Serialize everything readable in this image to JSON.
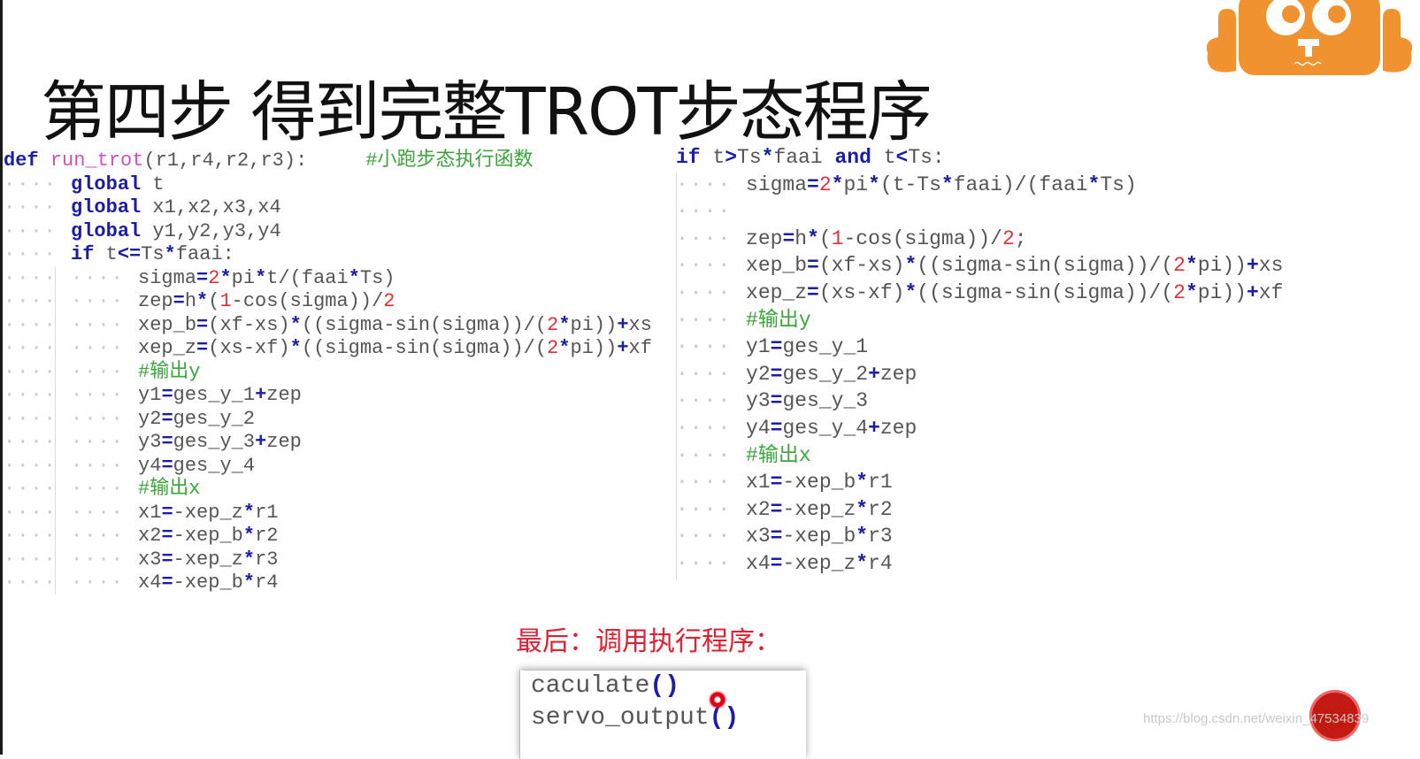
{
  "slide": {
    "title": "第四步 得到完整TROT步态程序",
    "watermark": "https://blog.csdn.net/weixin_47534839",
    "colors": {
      "keyword": "#1c1ca6",
      "function_name": "#d64fb8",
      "number": "#e0303a",
      "comment": "#3aa63a",
      "text": "#555555",
      "logo": "#f0922f",
      "final_label": "#e02030"
    }
  },
  "code_left": {
    "lines": [
      {
        "indent": 0,
        "tokens": [
          [
            "kw",
            "def"
          ],
          [
            "tx",
            " "
          ],
          [
            "fn",
            "run_trot"
          ],
          [
            "tx",
            "(r1,r4,r2,r3):"
          ],
          [
            "tx",
            "     "
          ],
          [
            "cm",
            "#小跑步态执行函数"
          ]
        ]
      },
      {
        "indent": 1,
        "tokens": [
          [
            "kw",
            "global"
          ],
          [
            "tx",
            " t"
          ]
        ]
      },
      {
        "indent": 1,
        "tokens": [
          [
            "kw",
            "global"
          ],
          [
            "tx",
            " x1,x2,x3,x4"
          ]
        ]
      },
      {
        "indent": 1,
        "tokens": [
          [
            "kw",
            "global"
          ],
          [
            "tx",
            " y1,y2,y3,y4"
          ]
        ]
      },
      {
        "indent": 1,
        "tokens": [
          [
            "kw",
            "if"
          ],
          [
            "tx",
            " t"
          ],
          [
            "op",
            "<="
          ],
          [
            "tx",
            "Ts"
          ],
          [
            "op",
            "*"
          ],
          [
            "tx",
            "faai:"
          ]
        ]
      },
      {
        "indent": 2,
        "tokens": [
          [
            "tx",
            "sigma"
          ],
          [
            "op",
            "="
          ],
          [
            "num",
            "2"
          ],
          [
            "op",
            "*"
          ],
          [
            "tx",
            "pi"
          ],
          [
            "op",
            "*"
          ],
          [
            "tx",
            "t/(faai"
          ],
          [
            "op",
            "*"
          ],
          [
            "tx",
            "Ts)"
          ]
        ]
      },
      {
        "indent": 2,
        "tokens": [
          [
            "tx",
            "zep"
          ],
          [
            "op",
            "="
          ],
          [
            "tx",
            "h"
          ],
          [
            "op",
            "*"
          ],
          [
            "tx",
            "("
          ],
          [
            "num",
            "1"
          ],
          [
            "tx",
            "-cos(sigma))/"
          ],
          [
            "num",
            "2"
          ]
        ]
      },
      {
        "indent": 2,
        "tokens": [
          [
            "tx",
            "xep_b"
          ],
          [
            "op",
            "="
          ],
          [
            "tx",
            "(xf-xs)"
          ],
          [
            "op",
            "*"
          ],
          [
            "tx",
            "((sigma-sin(sigma))/("
          ],
          [
            "num",
            "2"
          ],
          [
            "op",
            "*"
          ],
          [
            "tx",
            "pi))"
          ],
          [
            "op",
            "+"
          ],
          [
            "tx",
            "xs"
          ]
        ]
      },
      {
        "indent": 2,
        "tokens": [
          [
            "tx",
            "xep_z"
          ],
          [
            "op",
            "="
          ],
          [
            "tx",
            "(xs-xf)"
          ],
          [
            "op",
            "*"
          ],
          [
            "tx",
            "((sigma-sin(sigma))/("
          ],
          [
            "num",
            "2"
          ],
          [
            "op",
            "*"
          ],
          [
            "tx",
            "pi))"
          ],
          [
            "op",
            "+"
          ],
          [
            "tx",
            "xf"
          ]
        ]
      },
      {
        "indent": 2,
        "tokens": [
          [
            "cm",
            "#输出y"
          ]
        ]
      },
      {
        "indent": 2,
        "tokens": [
          [
            "tx",
            "y1"
          ],
          [
            "op",
            "="
          ],
          [
            "tx",
            "ges_y_1"
          ],
          [
            "op",
            "+"
          ],
          [
            "tx",
            "zep"
          ]
        ]
      },
      {
        "indent": 2,
        "tokens": [
          [
            "tx",
            "y2"
          ],
          [
            "op",
            "="
          ],
          [
            "tx",
            "ges_y_2"
          ]
        ]
      },
      {
        "indent": 2,
        "tokens": [
          [
            "tx",
            "y3"
          ],
          [
            "op",
            "="
          ],
          [
            "tx",
            "ges_y_3"
          ],
          [
            "op",
            "+"
          ],
          [
            "tx",
            "zep"
          ]
        ]
      },
      {
        "indent": 2,
        "tokens": [
          [
            "tx",
            "y4"
          ],
          [
            "op",
            "="
          ],
          [
            "tx",
            "ges_y_4"
          ]
        ]
      },
      {
        "indent": 2,
        "tokens": [
          [
            "cm",
            "#输出x"
          ]
        ]
      },
      {
        "indent": 2,
        "tokens": [
          [
            "tx",
            "x1"
          ],
          [
            "op",
            "="
          ],
          [
            "tx",
            "-xep_z"
          ],
          [
            "op",
            "*"
          ],
          [
            "tx",
            "r1"
          ]
        ]
      },
      {
        "indent": 2,
        "tokens": [
          [
            "tx",
            "x2"
          ],
          [
            "op",
            "="
          ],
          [
            "tx",
            "-xep_b"
          ],
          [
            "op",
            "*"
          ],
          [
            "tx",
            "r2"
          ]
        ]
      },
      {
        "indent": 2,
        "tokens": [
          [
            "tx",
            "x3"
          ],
          [
            "op",
            "="
          ],
          [
            "tx",
            "-xep_z"
          ],
          [
            "op",
            "*"
          ],
          [
            "tx",
            "r3"
          ]
        ]
      },
      {
        "indent": 2,
        "tokens": [
          [
            "tx",
            "x4"
          ],
          [
            "op",
            "="
          ],
          [
            "tx",
            "-xep_b"
          ],
          [
            "op",
            "*"
          ],
          [
            "tx",
            "r4"
          ]
        ]
      }
    ]
  },
  "code_right": {
    "lines": [
      {
        "indent": 0,
        "tokens": [
          [
            "kw",
            "if"
          ],
          [
            "tx",
            " t"
          ],
          [
            "op",
            ">"
          ],
          [
            "tx",
            "Ts"
          ],
          [
            "op",
            "*"
          ],
          [
            "tx",
            "faai "
          ],
          [
            "kw",
            "and"
          ],
          [
            "tx",
            " t"
          ],
          [
            "op",
            "<"
          ],
          [
            "tx",
            "Ts:"
          ]
        ]
      },
      {
        "indent": 1,
        "tokens": [
          [
            "tx",
            "sigma"
          ],
          [
            "op",
            "="
          ],
          [
            "num",
            "2"
          ],
          [
            "op",
            "*"
          ],
          [
            "tx",
            "pi"
          ],
          [
            "op",
            "*"
          ],
          [
            "tx",
            "(t-Ts"
          ],
          [
            "op",
            "*"
          ],
          [
            "tx",
            "faai)/(faai"
          ],
          [
            "op",
            "*"
          ],
          [
            "tx",
            "Ts)"
          ]
        ]
      },
      {
        "indent": 1,
        "tokens": []
      },
      {
        "indent": 1,
        "tokens": [
          [
            "tx",
            "zep"
          ],
          [
            "op",
            "="
          ],
          [
            "tx",
            "h"
          ],
          [
            "op",
            "*"
          ],
          [
            "tx",
            "("
          ],
          [
            "num",
            "1"
          ],
          [
            "tx",
            "-cos(sigma))/"
          ],
          [
            "num",
            "2"
          ],
          [
            "tx",
            ";"
          ]
        ]
      },
      {
        "indent": 1,
        "tokens": [
          [
            "tx",
            "xep_b"
          ],
          [
            "op",
            "="
          ],
          [
            "tx",
            "(xf-xs)"
          ],
          [
            "op",
            "*"
          ],
          [
            "tx",
            "((sigma-sin(sigma))/("
          ],
          [
            "num",
            "2"
          ],
          [
            "op",
            "*"
          ],
          [
            "tx",
            "pi))"
          ],
          [
            "op",
            "+"
          ],
          [
            "tx",
            "xs"
          ]
        ]
      },
      {
        "indent": 1,
        "tokens": [
          [
            "tx",
            "xep_z"
          ],
          [
            "op",
            "="
          ],
          [
            "tx",
            "(xs-xf)"
          ],
          [
            "op",
            "*"
          ],
          [
            "tx",
            "((sigma-sin(sigma))/("
          ],
          [
            "num",
            "2"
          ],
          [
            "op",
            "*"
          ],
          [
            "tx",
            "pi))"
          ],
          [
            "op",
            "+"
          ],
          [
            "tx",
            "xf"
          ]
        ]
      },
      {
        "indent": 1,
        "tokens": [
          [
            "cm",
            "#输出y"
          ]
        ]
      },
      {
        "indent": 1,
        "tokens": [
          [
            "tx",
            "y1"
          ],
          [
            "op",
            "="
          ],
          [
            "tx",
            "ges_y_1"
          ]
        ]
      },
      {
        "indent": 1,
        "tokens": [
          [
            "tx",
            "y2"
          ],
          [
            "op",
            "="
          ],
          [
            "tx",
            "ges_y_2"
          ],
          [
            "op",
            "+"
          ],
          [
            "tx",
            "zep"
          ]
        ]
      },
      {
        "indent": 1,
        "tokens": [
          [
            "tx",
            "y3"
          ],
          [
            "op",
            "="
          ],
          [
            "tx",
            "ges_y_3"
          ]
        ]
      },
      {
        "indent": 1,
        "tokens": [
          [
            "tx",
            "y4"
          ],
          [
            "op",
            "="
          ],
          [
            "tx",
            "ges_y_4"
          ],
          [
            "op",
            "+"
          ],
          [
            "tx",
            "zep"
          ]
        ]
      },
      {
        "indent": 1,
        "tokens": [
          [
            "cm",
            "#输出x"
          ]
        ]
      },
      {
        "indent": 1,
        "tokens": [
          [
            "tx",
            "x1"
          ],
          [
            "op",
            "="
          ],
          [
            "tx",
            "-xep_b"
          ],
          [
            "op",
            "*"
          ],
          [
            "tx",
            "r1"
          ]
        ]
      },
      {
        "indent": 1,
        "tokens": [
          [
            "tx",
            "x2"
          ],
          [
            "op",
            "="
          ],
          [
            "tx",
            "-xep_z"
          ],
          [
            "op",
            "*"
          ],
          [
            "tx",
            "r2"
          ]
        ]
      },
      {
        "indent": 1,
        "tokens": [
          [
            "tx",
            "x3"
          ],
          [
            "op",
            "="
          ],
          [
            "tx",
            "-xep_b"
          ],
          [
            "op",
            "*"
          ],
          [
            "tx",
            "r3"
          ]
        ]
      },
      {
        "indent": 1,
        "tokens": [
          [
            "tx",
            "x4"
          ],
          [
            "op",
            "="
          ],
          [
            "tx",
            "-xep_z"
          ],
          [
            "op",
            "*"
          ],
          [
            "tx",
            "r4"
          ]
        ]
      }
    ]
  },
  "final_call": {
    "label": "最后：调用执行程序：",
    "calls": [
      {
        "name": "caculate",
        "parens": "()"
      },
      {
        "name": "servo_output",
        "parens": "()"
      }
    ]
  },
  "icons": {
    "logo": "orange-robot-mascot-icon",
    "stamp": "red-round-seal-icon",
    "cursor": "red-cursor-highlight-icon"
  }
}
